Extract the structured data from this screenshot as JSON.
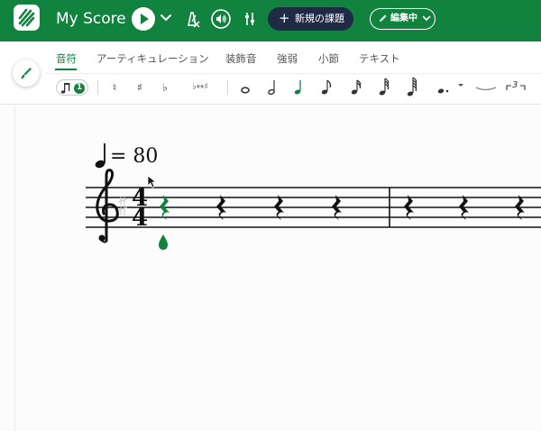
{
  "header": {
    "title": "My Score",
    "new_task_label": "新規の課題",
    "edit_mode_label": "編集中",
    "colors": {
      "brand": "#12823f",
      "new_task_bg": "#1f2a44"
    },
    "icons": [
      "logo-icon",
      "play-icon",
      "chevron-down-icon",
      "metronome-off-icon",
      "speaker-icon",
      "mixer-icon",
      "plus-icon",
      "pencil-icon"
    ]
  },
  "tabs": [
    {
      "label": "音符",
      "active": true
    },
    {
      "label": "アーティキュレーション",
      "active": false
    },
    {
      "label": "装飾音",
      "active": false
    },
    {
      "label": "強弱",
      "active": false
    },
    {
      "label": "小節",
      "active": false
    },
    {
      "label": "テキスト",
      "active": false
    }
  ],
  "toolbar": {
    "voice_number": "1",
    "natural": "♮",
    "sharp": "♯",
    "flat": "♭",
    "enharmonic": "♭↔♯",
    "tuplet": "3",
    "selected_duration": "quarter",
    "durations": [
      "whole",
      "half",
      "quarter",
      "eighth",
      "sixteenth",
      "thirty-second",
      "sixty-fourth"
    ]
  },
  "score": {
    "tempo_value": "= 80",
    "time_signature": {
      "top": "4",
      "bottom": "4"
    },
    "clef": "treble",
    "measure1_rests": 4,
    "measure2_rests": 3,
    "selected_rest_color": "#12823f"
  }
}
